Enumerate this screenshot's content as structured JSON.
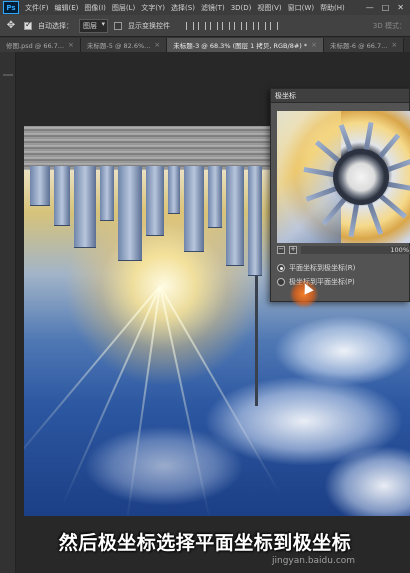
{
  "menubar": {
    "logo": "Ps",
    "items": [
      "文件(F)",
      "编辑(E)",
      "图像(I)",
      "图层(L)",
      "文字(Y)",
      "选择(S)",
      "滤镜(T)",
      "3D(D)",
      "视图(V)",
      "窗口(W)",
      "帮助(H)"
    ],
    "window_controls": [
      "—",
      "□",
      "✕"
    ]
  },
  "options": {
    "tool_icon": "move-tool-icon",
    "auto_select_label": "自动选择：",
    "auto_select_target": "图层",
    "show_transform_label": "显示变换控件",
    "mode_3d": "3D 模式："
  },
  "tabs": [
    {
      "label": "修图.psd @ 66.7...",
      "active": false
    },
    {
      "label": "未标题-5 @ 82.6%...",
      "active": false
    },
    {
      "label": "未标题-3 @ 68.3% (图层 1 拷贝, RGB/8#) *",
      "active": true
    },
    {
      "label": "未标题-6 @ 66.7...",
      "active": false
    }
  ],
  "dialog": {
    "title": "极坐标",
    "zoom_minus": "−",
    "zoom_plus": "+",
    "zoom_value": "100%",
    "options": [
      {
        "label": "平面坐标到极坐标(R)",
        "selected": true
      },
      {
        "label": "极坐标到平面坐标(P)",
        "selected": false
      }
    ]
  },
  "caption": "然后极坐标选择平面坐标到极坐标",
  "watermark": "jingyan.baidu.com",
  "colors": {
    "accent_cursor": "#f06414",
    "ps_blue": "#31a8ff"
  }
}
